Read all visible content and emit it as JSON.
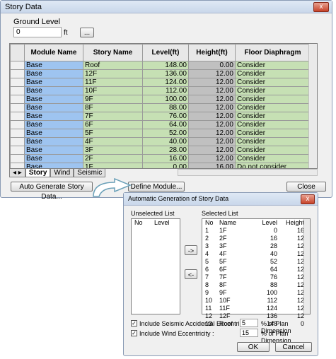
{
  "window": {
    "title": "Story Data",
    "close": "x"
  },
  "ground": {
    "label": "Ground Level",
    "value": "0",
    "unit": "ft",
    "browse": "..."
  },
  "grid": {
    "headers": [
      "Module Name",
      "Story Name",
      "Level(ft)",
      "Height(ft)",
      "Floor Diaphragm"
    ],
    "rows": [
      {
        "module": "Base",
        "story": "Roof",
        "level": "148.00",
        "height": "0.00",
        "floor": "Consider"
      },
      {
        "module": "Base",
        "story": "12F",
        "level": "136.00",
        "height": "12.00",
        "floor": "Consider"
      },
      {
        "module": "Base",
        "story": "11F",
        "level": "124.00",
        "height": "12.00",
        "floor": "Consider"
      },
      {
        "module": "Base",
        "story": "10F",
        "level": "112.00",
        "height": "12.00",
        "floor": "Consider"
      },
      {
        "module": "Base",
        "story": "9F",
        "level": "100.00",
        "height": "12.00",
        "floor": "Consider"
      },
      {
        "module": "Base",
        "story": "8F",
        "level": "88.00",
        "height": "12.00",
        "floor": "Consider"
      },
      {
        "module": "Base",
        "story": "7F",
        "level": "76.00",
        "height": "12.00",
        "floor": "Consider"
      },
      {
        "module": "Base",
        "story": "6F",
        "level": "64.00",
        "height": "12.00",
        "floor": "Consider"
      },
      {
        "module": "Base",
        "story": "5F",
        "level": "52.00",
        "height": "12.00",
        "floor": "Consider"
      },
      {
        "module": "Base",
        "story": "4F",
        "level": "40.00",
        "height": "12.00",
        "floor": "Consider"
      },
      {
        "module": "Base",
        "story": "3F",
        "level": "28.00",
        "height": "12.00",
        "floor": "Consider"
      },
      {
        "module": "Base",
        "story": "2F",
        "level": "16.00",
        "height": "12.00",
        "floor": "Consider"
      },
      {
        "module": "Base",
        "story": "1F",
        "level": "0.00",
        "height": "16.00",
        "floor": "Do not consider"
      }
    ]
  },
  "tabs": [
    "Story",
    "Wind",
    "Seismic"
  ],
  "buttons": {
    "auto": "Auto Generate Story Data...",
    "define": "Define Module...",
    "close": "Close"
  },
  "dialog": {
    "title": "Automatic Generation of Story Data",
    "close": "x",
    "unselected_label": "Unselected List",
    "unselected_headers": [
      "No",
      "Level"
    ],
    "selected_label": "Selected List",
    "selected_headers": [
      "No",
      "Name",
      "Level",
      "Height"
    ],
    "selected_rows": [
      [
        "1",
        "1F",
        "0",
        "16"
      ],
      [
        "2",
        "2F",
        "16",
        "12"
      ],
      [
        "3",
        "3F",
        "28",
        "12"
      ],
      [
        "4",
        "4F",
        "40",
        "12"
      ],
      [
        "5",
        "5F",
        "52",
        "12"
      ],
      [
        "6",
        "6F",
        "64",
        "12"
      ],
      [
        "7",
        "7F",
        "76",
        "12"
      ],
      [
        "8",
        "8F",
        "88",
        "12"
      ],
      [
        "9",
        "9F",
        "100",
        "12"
      ],
      [
        "10",
        "10F",
        "112",
        "12"
      ],
      [
        "11",
        "11F",
        "124",
        "12"
      ],
      [
        "12",
        "12F",
        "136",
        "12"
      ],
      [
        "13",
        "Roof",
        "148",
        "0"
      ]
    ],
    "move_right": "->",
    "move_left": "<-",
    "seismic_label": "Include Seismic Accidental Eccentricity :",
    "seismic_value": "5",
    "wind_label": "Include Wind Eccentricity :",
    "wind_value": "15",
    "pct_label": "% of  Plan Dimension",
    "ok": "OK",
    "cancel": "Cancel"
  }
}
